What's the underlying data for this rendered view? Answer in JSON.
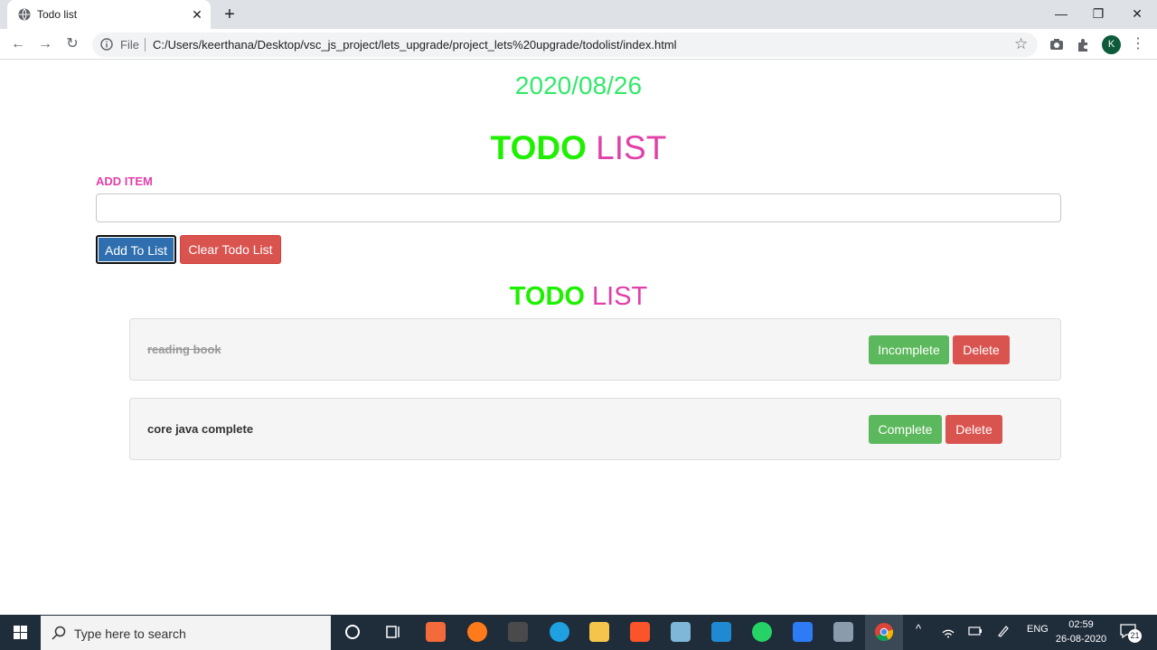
{
  "browser": {
    "tab_title": "Todo list",
    "tab_close": "✕",
    "new_tab": "+",
    "omnibox_scheme": "File",
    "url": "C:/Users/keerthana/Desktop/vsc_js_project/lets_upgrade/project_lets%20upgrade/todolist/index.html",
    "profile_initial": "K",
    "minimize": "—",
    "maximize": "❐",
    "close": "✕"
  },
  "page": {
    "date": "2020/08/26",
    "heading_todo": "TODO",
    "heading_list": "LIST",
    "add_label": "ADD ITEM",
    "add_input_value": "",
    "add_button": "Add To List",
    "clear_button": "Clear Todo List",
    "subheading_todo": "TODO",
    "subheading_list": "LIST",
    "items": [
      {
        "text": "reading book",
        "completed": true,
        "toggle_label": "Incomplete",
        "delete_label": "Delete"
      },
      {
        "text": "core java complete",
        "completed": false,
        "toggle_label": "Complete",
        "delete_label": "Delete"
      }
    ]
  },
  "taskbar": {
    "search_placeholder": "Type here to search",
    "language": "ENG",
    "time": "02:59",
    "date": "26-08-2020",
    "notification_count": "21"
  },
  "colors": {
    "date": "#33e86a",
    "todo_green": "#1ff000",
    "list_pink": "#e040a8",
    "btn_primary": "#2f6faf",
    "btn_danger": "#d9534f",
    "btn_success": "#5cb85c"
  }
}
